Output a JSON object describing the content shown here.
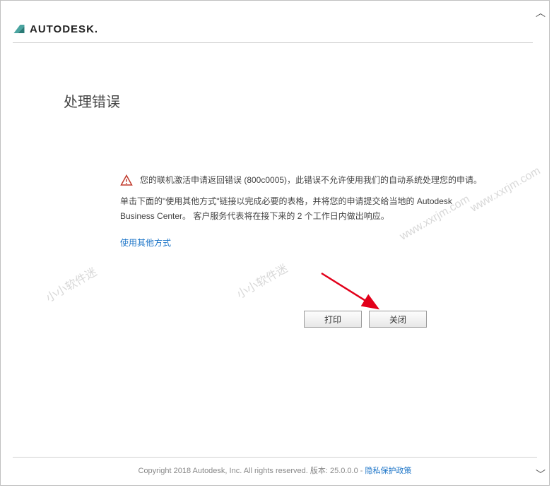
{
  "logo": {
    "text": "AUTODESK."
  },
  "title": "处理错误",
  "error": {
    "message": "您的联机激活申请返回错误 (800c0005)，此错误不允许使用我们的自动系统处理您的申请。"
  },
  "instruction": "单击下面的\"使用其他方式\"链接以完成必要的表格，并将您的申请提交给当地的 Autodesk Business Center。 客户服务代表将在接下来的 2 个工作日内做出响应。",
  "link": {
    "alt_method": "使用其他方式"
  },
  "buttons": {
    "print": "打印",
    "close": "关闭"
  },
  "footer": {
    "copyright": "Copyright 2018 Autodesk, Inc. All rights reserved.  版本: 25.0.0.0 - ",
    "privacy": "隐私保护政策"
  },
  "watermarks": {
    "text1": "小小软件迷",
    "text2": "www.xxrjm.com"
  }
}
